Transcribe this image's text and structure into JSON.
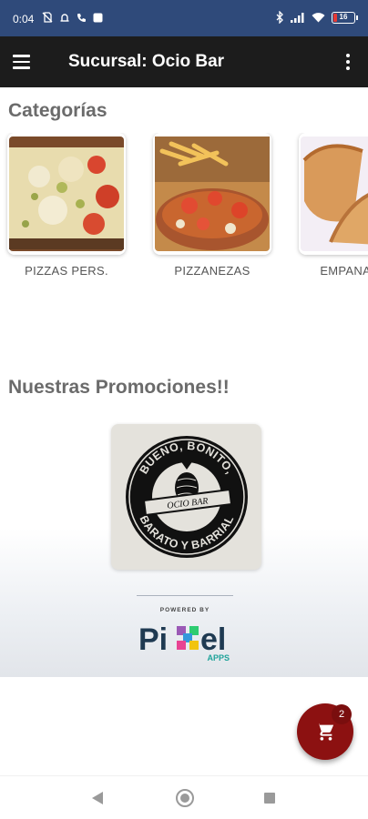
{
  "status_bar": {
    "time": "0:04",
    "battery": "16",
    "battery_color": "#e53935",
    "left_icons": [
      "no-sim-icon",
      "alarm-icon",
      "phone-icon",
      "notification-square-icon"
    ],
    "right_icons": [
      "bluetooth-icon",
      "signal-icon",
      "wifi-icon",
      "battery-icon"
    ]
  },
  "app_bar": {
    "title": "Sucursal: Ocio Bar",
    "menu_icon": "hamburger-menu-icon",
    "overflow_icon": "more-vertical-icon",
    "background": "#1c1c1c"
  },
  "categories": {
    "title": "Categorías",
    "items": [
      {
        "label": "PIZZAS PERS.",
        "image": "pizza-photo"
      },
      {
        "label": "PIZZANEZAS",
        "image": "pizzaneza-with-fries-photo"
      },
      {
        "label": "EMPANADAS",
        "image": "empanadas-photo"
      }
    ]
  },
  "promotions": {
    "title": "Nuestras Promociones!!",
    "items": [
      {
        "image": "ocio-bar-logo",
        "logo_text": [
          "BUENO, BONITO,",
          "OCIO BAR",
          "BARATO Y BARRIAL"
        ]
      }
    ]
  },
  "footer": {
    "powered_by": "POWERED BY",
    "brand": [
      "Pi",
      "x",
      "el"
    ],
    "brand_sub": "APPS"
  },
  "cart": {
    "icon": "shopping-cart-icon",
    "count": "2",
    "color": "#8c1111"
  },
  "nav_bar": {
    "icons": [
      "back-triangle-icon",
      "home-circle-icon",
      "recents-square-icon"
    ]
  }
}
